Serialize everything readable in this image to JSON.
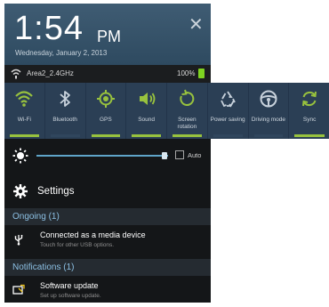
{
  "header": {
    "time": "1:54",
    "ampm": "PM",
    "date": "Wednesday, January 2, 2013"
  },
  "status_bar": {
    "network": "Area2_2.4GHz",
    "battery": "100%"
  },
  "quick_toggles": [
    {
      "label": "Wi-Fi",
      "icon": "wifi-icon",
      "on": true
    },
    {
      "label": "Bluetooth",
      "icon": "bluetooth-icon",
      "on": false
    },
    {
      "label": "GPS",
      "icon": "gps-icon",
      "on": true
    },
    {
      "label": "Sound",
      "icon": "sound-icon",
      "on": true
    },
    {
      "label": "Screen rotation",
      "icon": "rotation-icon",
      "on": true
    },
    {
      "label": "Power saving",
      "icon": "power-saving-icon",
      "on": false
    },
    {
      "label": "Driving mode",
      "icon": "steering-wheel-icon",
      "on": false
    },
    {
      "label": "Sync",
      "icon": "sync-icon",
      "on": true
    }
  ],
  "brightness": {
    "auto_label": "Auto",
    "level": 0.97,
    "auto": false
  },
  "settings": {
    "label": "Settings"
  },
  "ongoing": {
    "header": "Ongoing (1)",
    "items": [
      {
        "title": "Connected as a media device",
        "subtitle": "Touch for other USB options.",
        "icon": "usb-icon"
      }
    ]
  },
  "notifications": {
    "header": "Notifications (1)",
    "items": [
      {
        "title": "Software update",
        "subtitle": "Set up software update.",
        "icon": "software-update-icon"
      }
    ]
  },
  "colors": {
    "header_bg": "#3f5c73",
    "toggle_bg": "#2b3f55",
    "accent_green": "#98c23e",
    "section_text": "#8cc0e4"
  }
}
